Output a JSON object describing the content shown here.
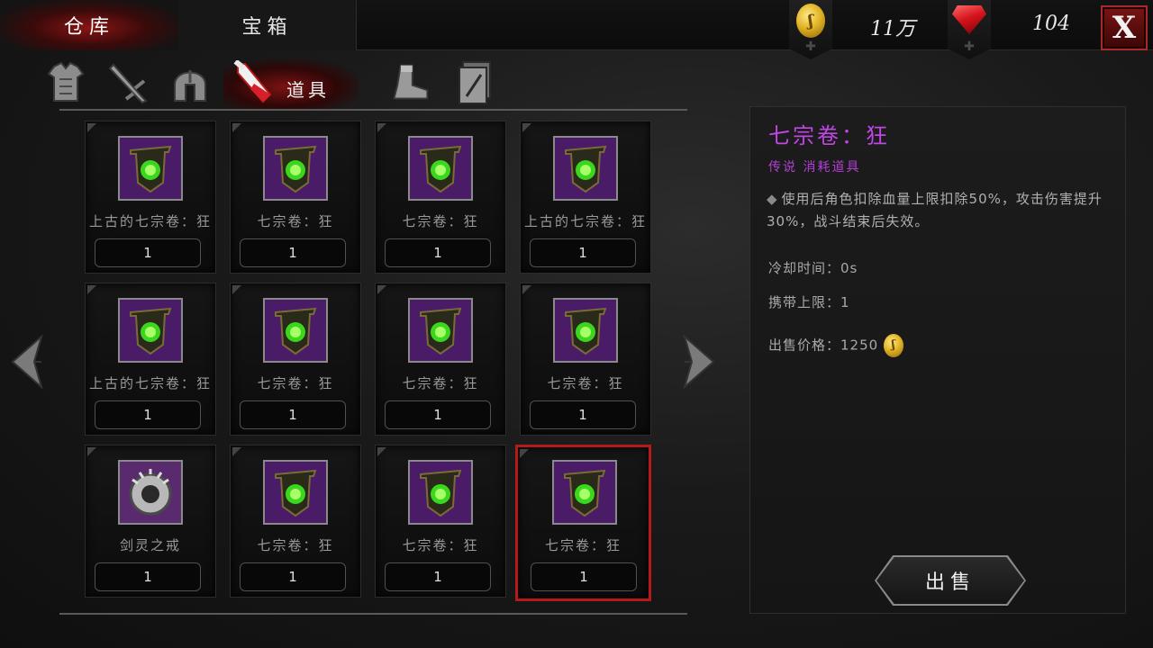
{
  "tabs": [
    {
      "label": "仓库",
      "active": true
    },
    {
      "label": "宝箱",
      "active": false
    }
  ],
  "currency": {
    "gold": {
      "icon": "gold-coin-icon",
      "value": "11万"
    },
    "gems": {
      "icon": "red-gem-icon",
      "value": "104"
    }
  },
  "close_label": "X",
  "categories": [
    {
      "icon": "armor-icon",
      "active": false
    },
    {
      "icon": "sword-icon",
      "active": false
    },
    {
      "icon": "helmet-icon",
      "active": false
    },
    {
      "icon": "potion-icon",
      "active": true,
      "label": "道具"
    },
    {
      "icon": "boot-icon",
      "active": false
    },
    {
      "icon": "scroll-card-icon",
      "active": false
    }
  ],
  "active_category_label": "道具",
  "items": [
    {
      "name": "上古的七宗卷：狂",
      "count": "1",
      "icon": "banner-scroll-icon"
    },
    {
      "name": "七宗卷：狂",
      "count": "1",
      "icon": "banner-scroll-icon"
    },
    {
      "name": "七宗卷：狂",
      "count": "1",
      "icon": "banner-scroll-icon"
    },
    {
      "name": "上古的七宗卷：狂",
      "count": "1",
      "icon": "banner-scroll-icon"
    },
    {
      "name": "上古的七宗卷：狂",
      "count": "1",
      "icon": "banner-scroll-icon"
    },
    {
      "name": "七宗卷：狂",
      "count": "1",
      "icon": "banner-scroll-icon"
    },
    {
      "name": "七宗卷：狂",
      "count": "1",
      "icon": "banner-scroll-icon"
    },
    {
      "name": "七宗卷：狂",
      "count": "1",
      "icon": "banner-scroll-icon"
    },
    {
      "name": "剑灵之戒",
      "count": "1",
      "icon": "spiked-ring-icon"
    },
    {
      "name": "七宗卷：狂",
      "count": "1",
      "icon": "banner-scroll-icon"
    },
    {
      "name": "七宗卷：狂",
      "count": "1",
      "icon": "banner-scroll-icon"
    },
    {
      "name": "七宗卷：狂",
      "count": "1",
      "icon": "banner-scroll-icon",
      "selected": true
    }
  ],
  "detail": {
    "title": "七宗卷：狂",
    "subtitle": "传说 消耗道具",
    "description": "使用后角色扣除血量上限扣除50%，攻击伤害提升30%，战斗结束后失效。",
    "cooldown": "冷却时间：0s",
    "carry_limit": "携带上限：1",
    "sell_price_label": "出售价格：",
    "sell_price_value": "1250",
    "sell_button": "出售"
  },
  "colors": {
    "accent_red": "#b51a1a",
    "legend_purple": "#c245e6",
    "gold": "#e2b324"
  }
}
